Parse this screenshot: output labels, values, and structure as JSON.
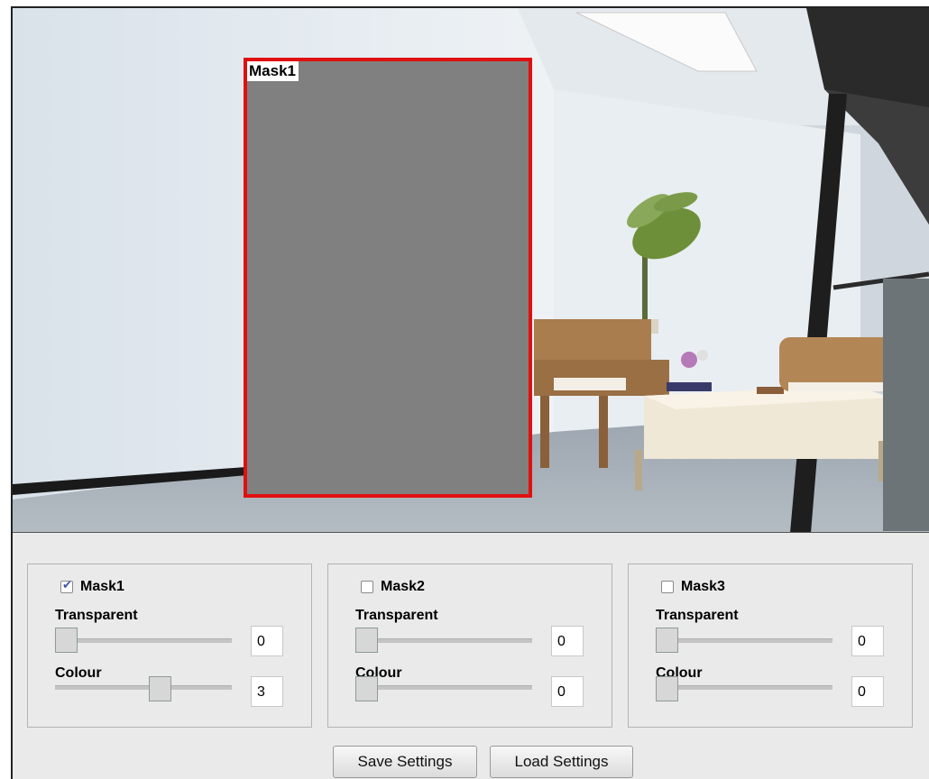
{
  "video": {
    "overlay_label": "Mask1",
    "overlay_color": "#808080",
    "overlay_border_color": "#e01010"
  },
  "masks": [
    {
      "label": "Mask1",
      "checked": true,
      "transparent_label": "Transparent",
      "transparent_value": "0",
      "colour_label": "Colour",
      "colour_value": "3",
      "transparent_level": 0,
      "colour_level": 0.6
    },
    {
      "label": "Mask2",
      "checked": false,
      "transparent_label": "Transparent",
      "transparent_value": "0",
      "colour_label": "Colour",
      "colour_value": "0",
      "transparent_level": 0,
      "colour_level": 0
    },
    {
      "label": "Mask3",
      "checked": false,
      "transparent_label": "Transparent",
      "transparent_value": "0",
      "colour_label": "Colour",
      "colour_value": "0",
      "transparent_level": 0,
      "colour_level": 0
    }
  ],
  "buttons": {
    "save_label": "Save Settings",
    "load_label": "Load Settings"
  },
  "icons": {
    "checkbox_checked": "check-icon"
  }
}
